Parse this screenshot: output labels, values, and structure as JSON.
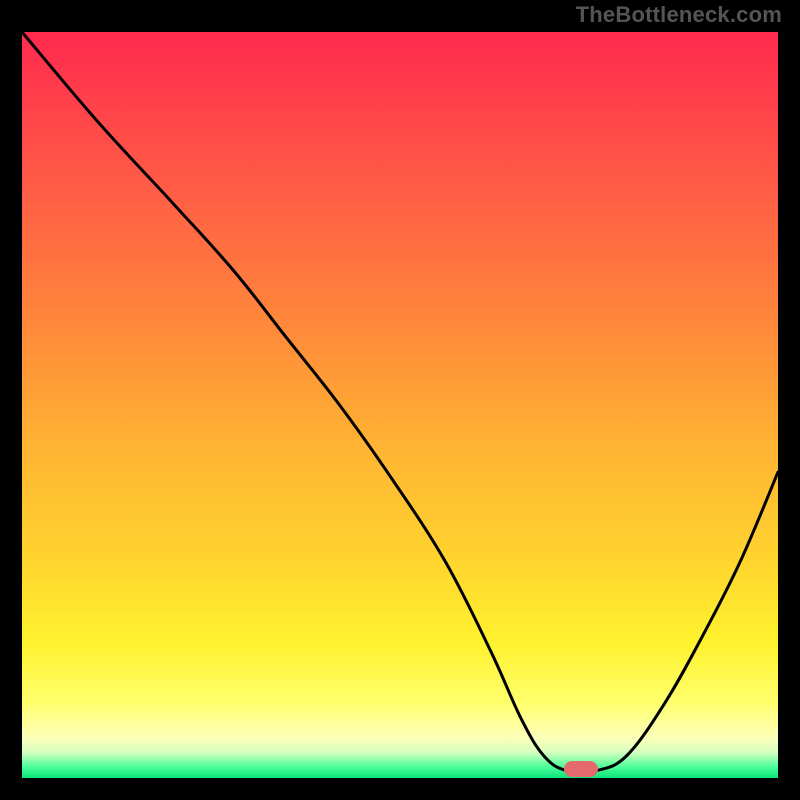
{
  "watermark": "TheBottleneck.com",
  "colors": {
    "border": "#000000",
    "curve": "#000000",
    "marker": "#e46a6e",
    "gradient_stops": [
      {
        "pos": 0.0,
        "color": "#ff2a4e"
      },
      {
        "pos": 0.2,
        "color": "#ff5a46"
      },
      {
        "pos": 0.4,
        "color": "#ff8a3a"
      },
      {
        "pos": 0.55,
        "color": "#ffb233"
      },
      {
        "pos": 0.7,
        "color": "#ffd22e"
      },
      {
        "pos": 0.82,
        "color": "#fff22e"
      },
      {
        "pos": 0.9,
        "color": "#ffff6e"
      },
      {
        "pos": 0.945,
        "color": "#fdffb8"
      },
      {
        "pos": 0.965,
        "color": "#d8ffbf"
      },
      {
        "pos": 0.985,
        "color": "#4dff9a"
      },
      {
        "pos": 1.0,
        "color": "#0be27a"
      }
    ]
  },
  "chart_data": {
    "type": "line",
    "title": "",
    "xlabel": "",
    "ylabel": "",
    "xlim": [
      0,
      100
    ],
    "ylim": [
      0,
      100
    ],
    "x": [
      0,
      10,
      20,
      28,
      35,
      42,
      49,
      56,
      62,
      66,
      69,
      72,
      76,
      80,
      85,
      90,
      95,
      100
    ],
    "values": [
      100,
      88,
      77,
      68,
      59,
      50,
      40,
      29,
      17,
      8,
      3,
      1,
      1,
      3,
      10,
      19,
      29,
      41
    ],
    "marker": {
      "x": 74,
      "y": 1.2,
      "w": 4.5,
      "h": 2.2
    },
    "grid": false,
    "legend": "none"
  }
}
